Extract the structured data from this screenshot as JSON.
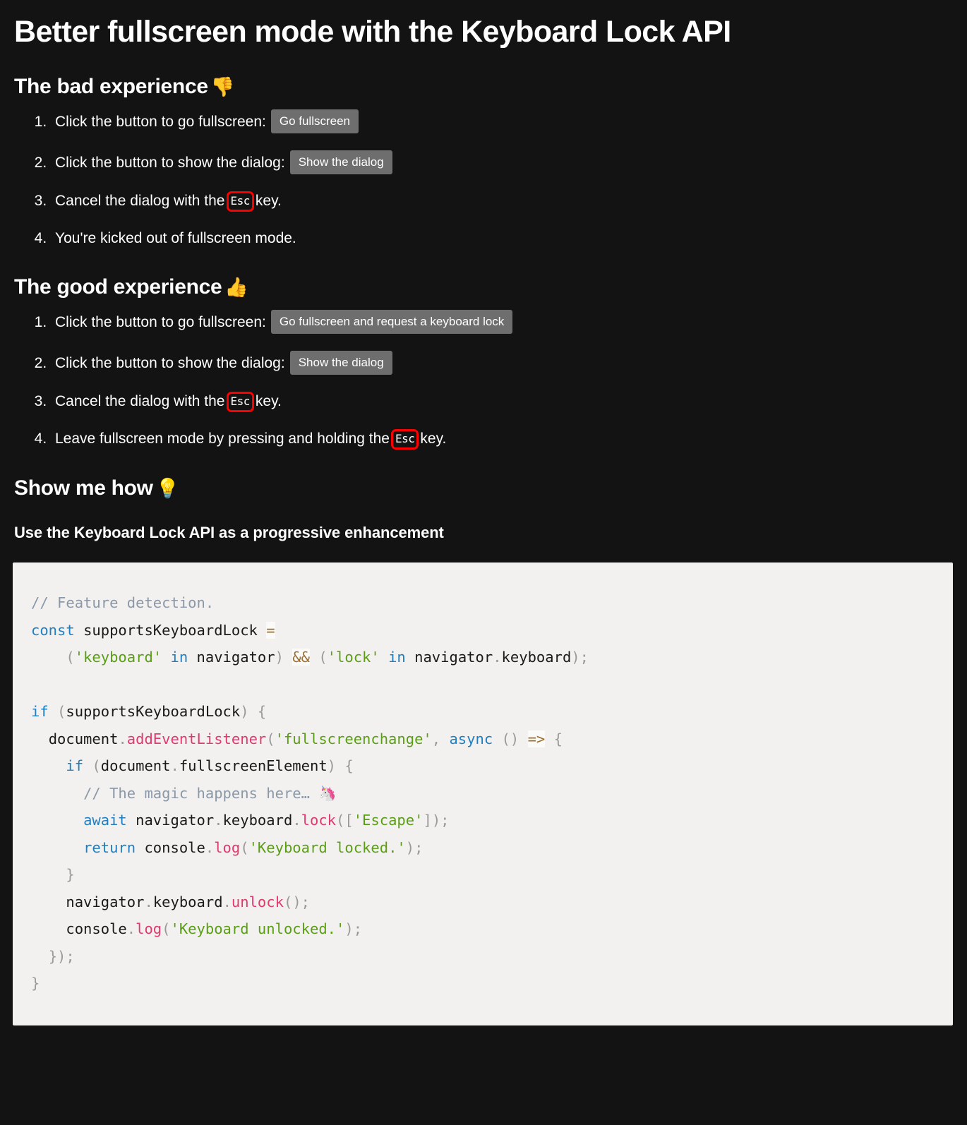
{
  "page": {
    "title": "Better fullscreen mode with the Keyboard Lock API",
    "background_color": "#131313",
    "text_color": "#ffffff"
  },
  "sections": {
    "bad": {
      "heading": "The bad experience",
      "heading_emoji": "👎",
      "emoji_name": "thumbs-down-emoji",
      "steps": [
        {
          "text_before": "Click the button to go fullscreen:",
          "button": "Go fullscreen",
          "text_after": ""
        },
        {
          "text_before": "Click the button to show the dialog:",
          "button": "Show the dialog",
          "text_after": ""
        },
        {
          "text_before": "Cancel the dialog with the",
          "key": "Esc",
          "text_after": "key."
        },
        {
          "text_before": "You're kicked out of fullscreen mode.",
          "text_after": ""
        }
      ]
    },
    "good": {
      "heading": "The good experience",
      "heading_emoji": "👍",
      "emoji_name": "thumbs-up-emoji",
      "steps": [
        {
          "text_before": "Click the button to go fullscreen:",
          "button": "Go fullscreen and request a keyboard lock",
          "text_after": ""
        },
        {
          "text_before": "Click the button to show the dialog:",
          "button": "Show the dialog",
          "text_after": ""
        },
        {
          "text_before": "Cancel the dialog with the",
          "key": "Esc",
          "text_after": "key."
        },
        {
          "text_before": "Leave fullscreen mode by pressing and holding the",
          "key": "Esc",
          "text_after": "key."
        }
      ]
    },
    "how": {
      "heading": "Show me how",
      "heading_emoji": "💡",
      "emoji_name": "light-bulb-emoji",
      "subheading": "Use the Keyboard Lock API as a progressive enhancement"
    }
  },
  "code": {
    "language": "javascript",
    "background_color": "#f2f1ef",
    "lines": [
      "// Feature detection.",
      "const supportsKeyboardLock =",
      "    ('keyboard' in navigator) && ('lock' in navigator.keyboard);",
      "",
      "if (supportsKeyboardLock) {",
      "  document.addEventListener('fullscreenchange', async () => {",
      "    if (document.fullscreenElement) {",
      "      // The magic happens here… 🦄",
      "      await navigator.keyboard.lock(['Escape']);",
      "      return console.log('Keyboard locked.');",
      "    }",
      "    navigator.keyboard.unlock();",
      "    console.log('Keyboard unlocked.');",
      "  });",
      "}"
    ],
    "colors": {
      "comment": "#8b98a8",
      "keyword": "#1f7fc2",
      "string": "#5a9e14",
      "function": "#e03a6d",
      "punctuation": "#9a9a9a",
      "operator": "#9a7033",
      "plain": "#1a1a1a"
    }
  }
}
